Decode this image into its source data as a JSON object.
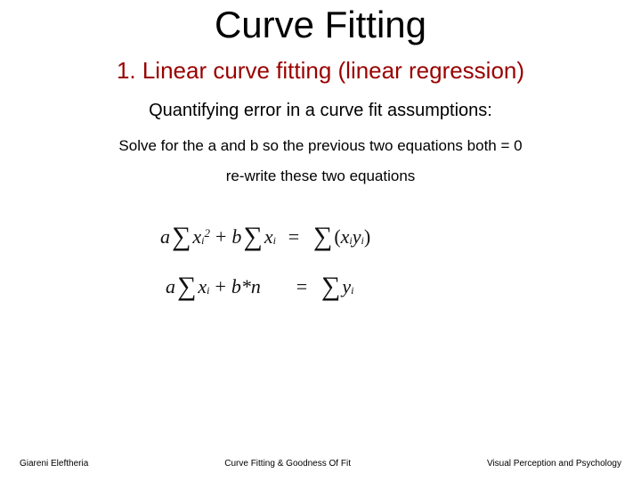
{
  "title": "Curve Fitting",
  "subtitle": "1. Linear curve fitting (linear regression)",
  "line1": "Quantifying error in a curve fit assumptions:",
  "line2": "Solve for the a and b so the previous two equations both = 0",
  "line3": "re-write these two equations",
  "equations": {
    "eq1_lhs_a": "a",
    "eq1_lhs_xi2": "x",
    "eq1_lhs_plus": "+",
    "eq1_lhs_b": "b",
    "eq1_lhs_xi": "x",
    "eq1_eq": "=",
    "eq1_rhs_xi": "x",
    "eq1_rhs_yi": "y",
    "eq2_lhs_a": "a",
    "eq2_lhs_xi": "x",
    "eq2_lhs_plus": "+",
    "eq2_lhs_bn": "b*n",
    "eq2_eq": "=",
    "eq2_rhs_yi": "y",
    "sub_i": "i",
    "sup_2": "2",
    "sigma": "∑",
    "lparen": "(",
    "rparen": ")"
  },
  "footer": {
    "left": "Giareni Eleftheria",
    "mid": "Curve Fitting & Goodness Of Fit",
    "right": "Visual Perception and Psychology"
  }
}
